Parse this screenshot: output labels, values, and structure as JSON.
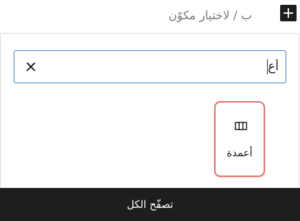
{
  "hint": {
    "text": "ب / لاختيار مكوّن"
  },
  "add_button": {
    "icon": "plus-icon"
  },
  "search": {
    "value": "أع",
    "clear_icon": "close-icon"
  },
  "results": [
    {
      "label": "أعمدة",
      "icon": "columns-icon"
    }
  ],
  "footer": {
    "browse_all_label": "تصفّح الكل"
  },
  "colors": {
    "focus_border": "#3b7cc3",
    "highlight_border": "#e06d6d",
    "footer_bg": "#1e1e1e",
    "hint_text": "#7a7a7a"
  }
}
